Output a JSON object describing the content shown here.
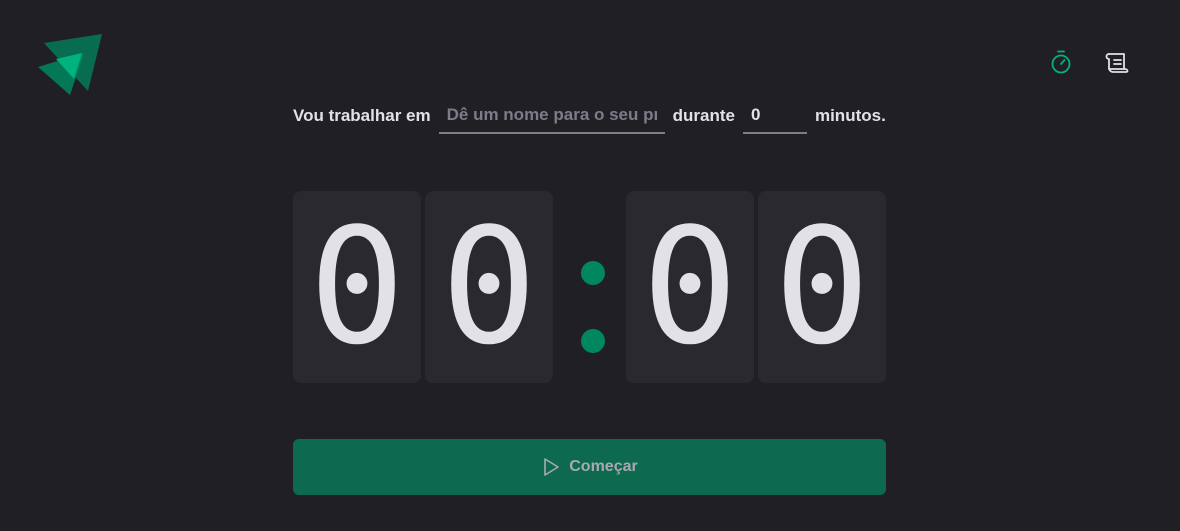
{
  "app": {
    "colors": {
      "background": "#202024",
      "accent": "#00875f",
      "button": "#0d6a4f",
      "digit_bg": "#29292e",
      "text": "#e1e1e6",
      "muted": "#7c7c8a"
    }
  },
  "header": {
    "logo_icon": "triangles-logo-icon",
    "nav": [
      {
        "icon": "timer-icon",
        "active": true
      },
      {
        "icon": "scroll-history-icon",
        "active": false
      }
    ]
  },
  "form": {
    "prefix_label": "Vou trabalhar em",
    "task_placeholder": "Dê um nome para o seu projeto",
    "task_value": "",
    "middle_label": "durante",
    "minutes_value": "0",
    "suffix_label": "minutos."
  },
  "countdown": {
    "minutes_tens": "0",
    "minutes_ones": "0",
    "separator": ":",
    "seconds_tens": "0",
    "seconds_ones": "0"
  },
  "start_button": {
    "label": "Começar",
    "icon": "play-icon"
  }
}
